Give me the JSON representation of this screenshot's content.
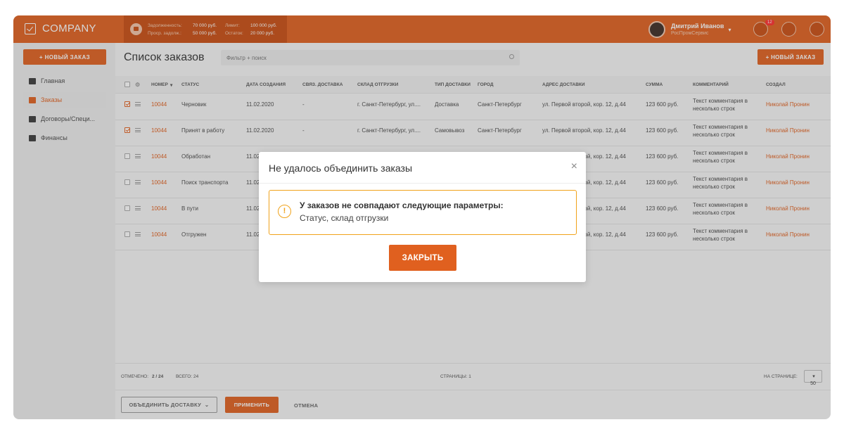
{
  "brand": {
    "name": "COMPANY"
  },
  "debt": {
    "rows": [
      [
        "Задолженность:",
        "70 000 руб.",
        "Лимит:",
        "100 000 руб."
      ],
      [
        "Проср. задолж.:",
        "50 000 руб.",
        "Остаток:",
        "20 000 руб."
      ]
    ]
  },
  "user": {
    "name": "Дмитрий Иванов",
    "company": "РосПромСервис",
    "notifications": "12"
  },
  "sidebar": {
    "new_order": "+ НОВЫЙ ЗАКАЗ",
    "items": [
      {
        "label": "Главная"
      },
      {
        "label": "Заказы"
      },
      {
        "label": "Договоры/Специ..."
      },
      {
        "label": "Финансы"
      }
    ]
  },
  "main": {
    "title": "Список заказов",
    "filter_placeholder": "Фильтр + поиск",
    "new_order": "+ НОВЫЙ ЗАКАЗ"
  },
  "table": {
    "columns": [
      "НОМЕР",
      "СТАТУС",
      "ДАТА СОЗДАНИЯ",
      "СВЯЗ. ДОСТАВКА",
      "СКЛАД ОТГРУЗКИ",
      "ТИП ДОСТАВКИ",
      "ГОРОД",
      "АДРЕС ДОСТАВКИ",
      "СУММА",
      "КОММЕНТАРИЙ",
      "СОЗДАЛ"
    ],
    "rows": [
      {
        "checked": true,
        "num": "10044",
        "status": "Черновик",
        "date": "11.02.2020",
        "linked": "-",
        "warehouse": "г. Санкт-Петербург, ул....",
        "type": "Доставка",
        "city": "Санкт-Петербург",
        "address": "ул. Первой второй, кор. 12, д.44",
        "sum": "123 600 руб.",
        "comment1": "Текст комментария в",
        "comment2": "несколько строк",
        "author": "Николай Пронин"
      },
      {
        "checked": true,
        "num": "10044",
        "status": "Принят в работу",
        "date": "11.02.2020",
        "linked": "-",
        "warehouse": "г. Санкт-Петербург, ул....",
        "type": "Самовывоз",
        "city": "Санкт-Петербург",
        "address": "ул. Первой второй, кор. 12, д.44",
        "sum": "123 600 руб.",
        "comment1": "Текст комментария в",
        "comment2": "несколько строк",
        "author": "Николай Пронин"
      },
      {
        "checked": false,
        "num": "10044",
        "status": "Обработан",
        "date": "11.02.2020",
        "linked": "",
        "warehouse": "",
        "type": "",
        "city": "",
        "address": "ул. Первой второй, кор. 12, д.44",
        "sum": "123 600 руб.",
        "comment1": "Текст комментария в",
        "comment2": "несколько строк",
        "author": "Николай Пронин"
      },
      {
        "checked": false,
        "num": "10044",
        "status": "Поиск транспорта",
        "date": "11.02.2020",
        "linked": "",
        "warehouse": "",
        "type": "",
        "city": "",
        "address": "ул. Первой второй, кор. 12, д.44",
        "sum": "123 600 руб.",
        "comment1": "Текст комментария в",
        "comment2": "несколько строк",
        "author": "Николай Пронин"
      },
      {
        "checked": false,
        "num": "10044",
        "status": "В пути",
        "date": "11.02.2020",
        "linked": "",
        "warehouse": "",
        "type": "",
        "city": "",
        "address": "ул. Первой второй, кор. 12, д.44",
        "sum": "123 600 руб.",
        "comment1": "Текст комментария в",
        "comment2": "несколько строк",
        "author": "Николай Пронин"
      },
      {
        "checked": false,
        "num": "10044",
        "status": "Отгружен",
        "date": "11.02.2020",
        "linked": "",
        "warehouse": "",
        "type": "",
        "city": "",
        "address": "ул. Первой второй, кор. 12, д.44",
        "sum": "123 600 руб.",
        "comment1": "Текст комментария в",
        "comment2": "несколько строк",
        "author": "Николай Пронин"
      }
    ]
  },
  "footer": {
    "selected_label": "ОТМЕЧЕНО:",
    "selected_value": "2 / 24",
    "total": "ВСЕГО: 24",
    "pages": "СТРАНИЦЫ: 1",
    "per_page_label": "НА СТРАНИЦЕ:",
    "per_page_value": "50",
    "merge": "ОБЪЕДИНИТЬ ДОСТАВКУ",
    "apply": "ПРИМЕНИТЬ",
    "cancel": "ОТМЕНА"
  },
  "modal": {
    "title": "Не удалось объединить заказы",
    "alert_heading": "У заказов не совпадают следующие параметры:",
    "alert_text": "Статус, склад отгрузки",
    "close_button": "ЗАКРЫТЬ"
  },
  "colors": {
    "accent": "#e0601f",
    "warning": "#f0a21a",
    "badge": "#ff2d2d"
  }
}
